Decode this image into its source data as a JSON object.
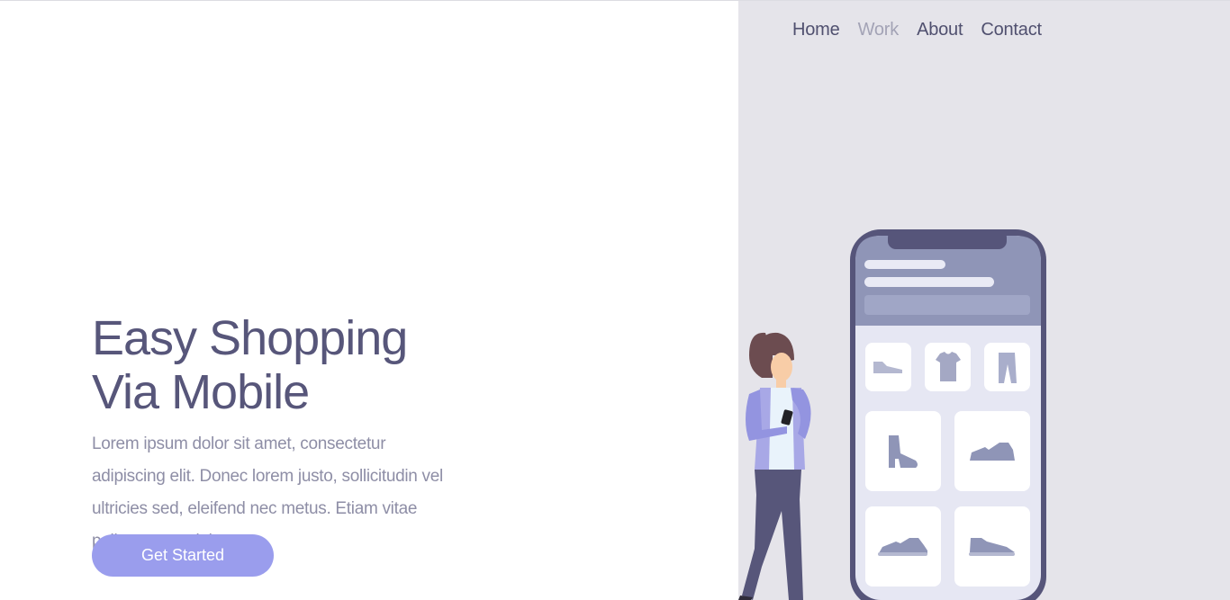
{
  "nav": {
    "items": [
      {
        "label": "Home",
        "active": false
      },
      {
        "label": "Work",
        "active": true
      },
      {
        "label": "About",
        "active": false
      },
      {
        "label": "Contact",
        "active": false
      }
    ]
  },
  "hero": {
    "title_line1": "Easy Shopping",
    "title_line2": "Via Mobile",
    "body": "Lorem ipsum dolor sit amet, consectetur adipiscing elit. Donec lorem justo, sollicitudin vel ultricies sed, eleifend nec metus. Etiam vitae pellentesque dolor.",
    "cta_label": "Get Started"
  },
  "colors": {
    "accent": "#9a9ded",
    "heading": "#57567a",
    "body_text": "#8e8ea6",
    "panel_bg": "#e5e4ea",
    "phone_frame": "#56557a"
  },
  "illustration": {
    "product_icons": [
      "shoe-icon",
      "tshirt-icon",
      "pants-icon",
      "boot-icon",
      "sneaker-icon",
      "sneaker-icon",
      "sneaker-icon"
    ]
  }
}
